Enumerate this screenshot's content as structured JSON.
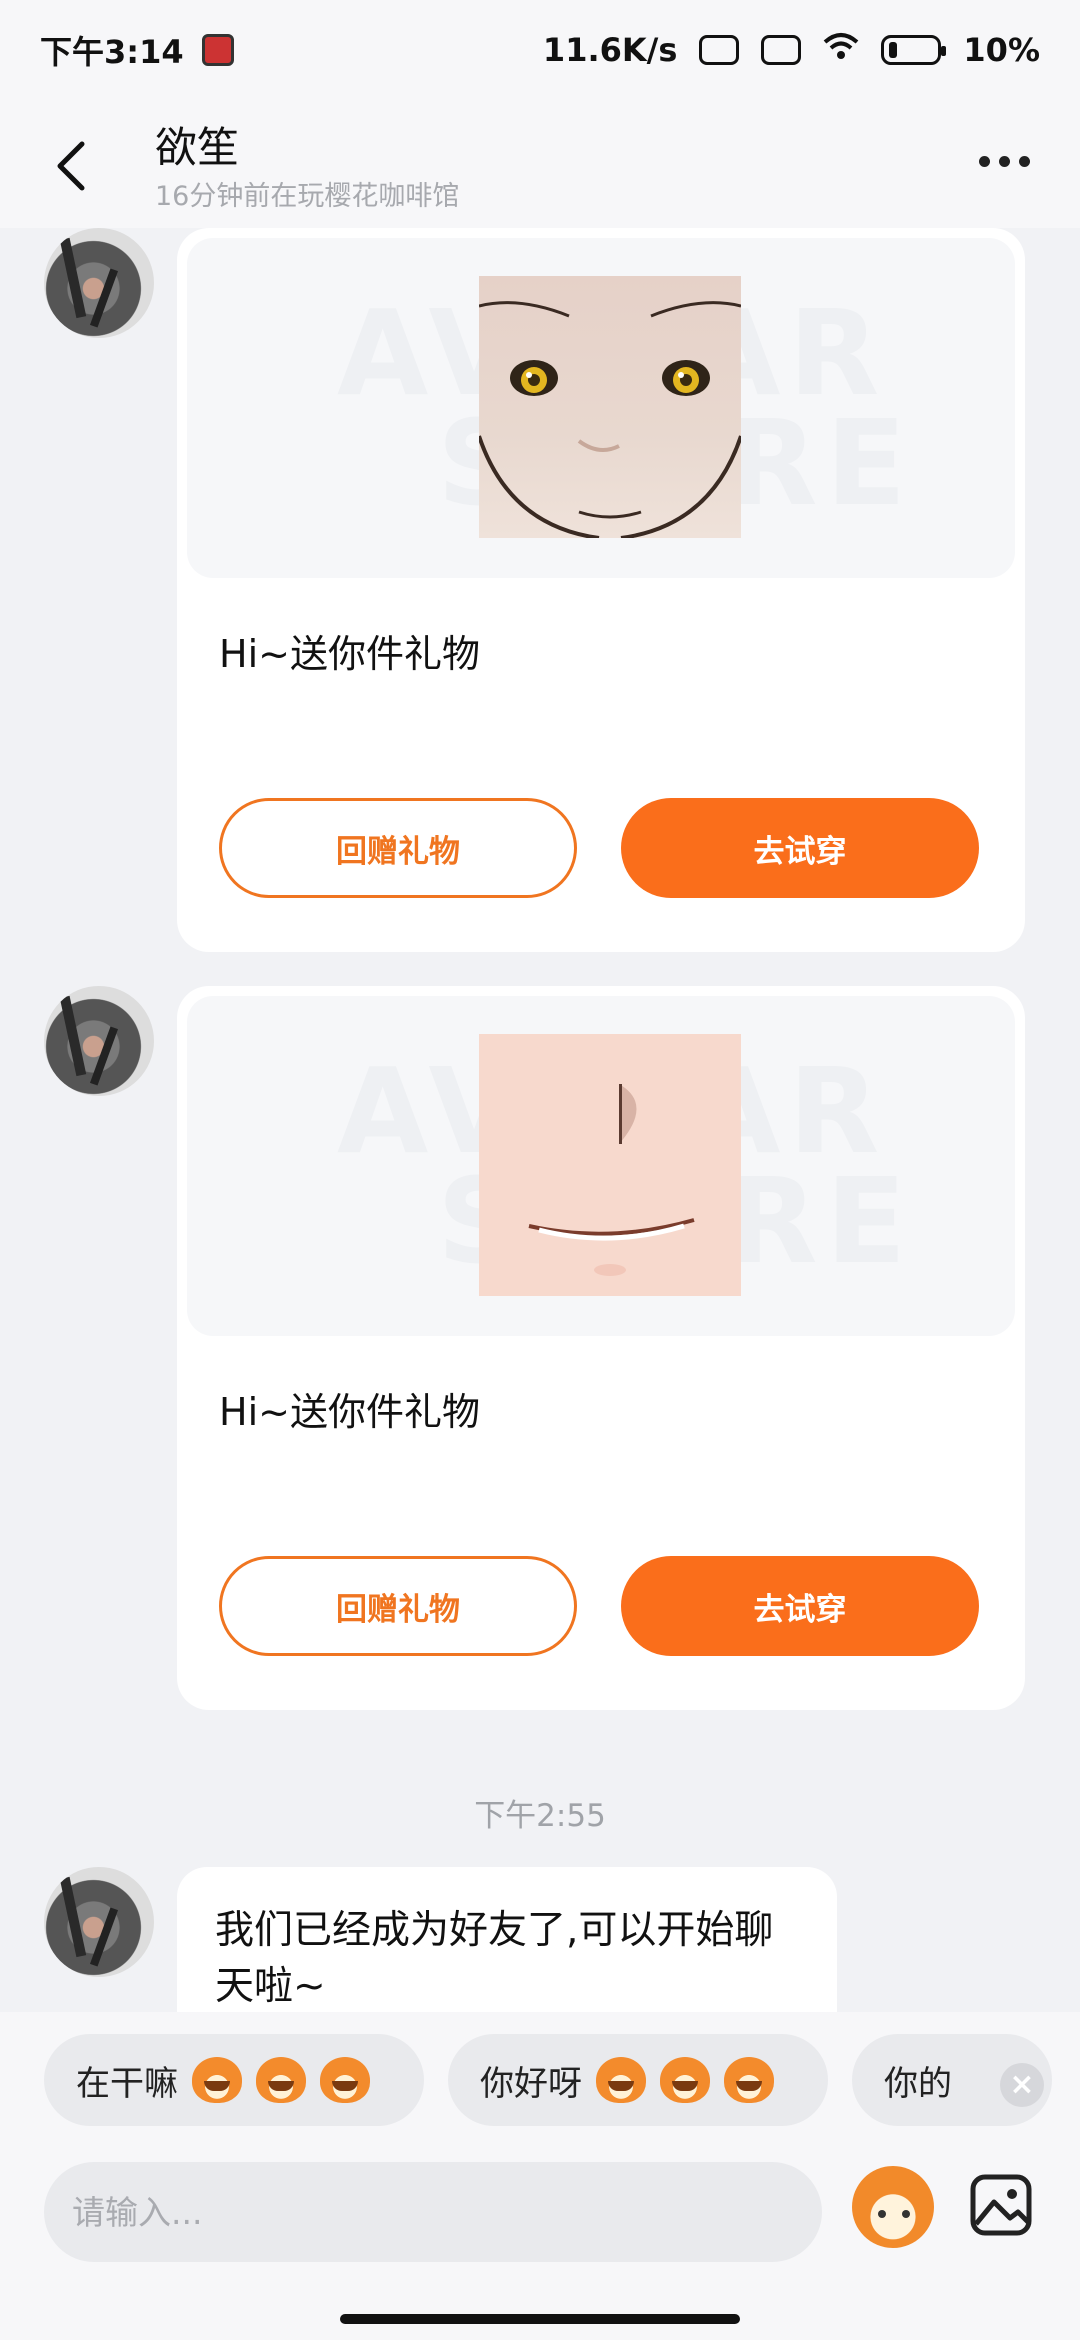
{
  "status_bar": {
    "time": "下午3:14",
    "network_speed": "11.6K/s",
    "battery": "10%"
  },
  "header": {
    "title": "欲笙",
    "subtitle": "16分钟前在玩樱花咖啡馆"
  },
  "messages": [
    {
      "type": "gift",
      "text": "Hi~送你件礼物",
      "return_gift_label": "回赠礼物",
      "try_on_label": "去试穿"
    },
    {
      "type": "gift",
      "text": "Hi~送你件礼物",
      "return_gift_label": "回赠礼物",
      "try_on_label": "去试穿"
    }
  ],
  "timestamp": "下午2:55",
  "text_message": "我们已经成为好友了,可以开始聊天啦~",
  "quick_replies": [
    "在干嘛",
    "你好呀",
    "你的"
  ],
  "input": {
    "placeholder": "请输入..."
  },
  "colors": {
    "accent": "#fa6e1b",
    "background": "#f1f2f5"
  }
}
